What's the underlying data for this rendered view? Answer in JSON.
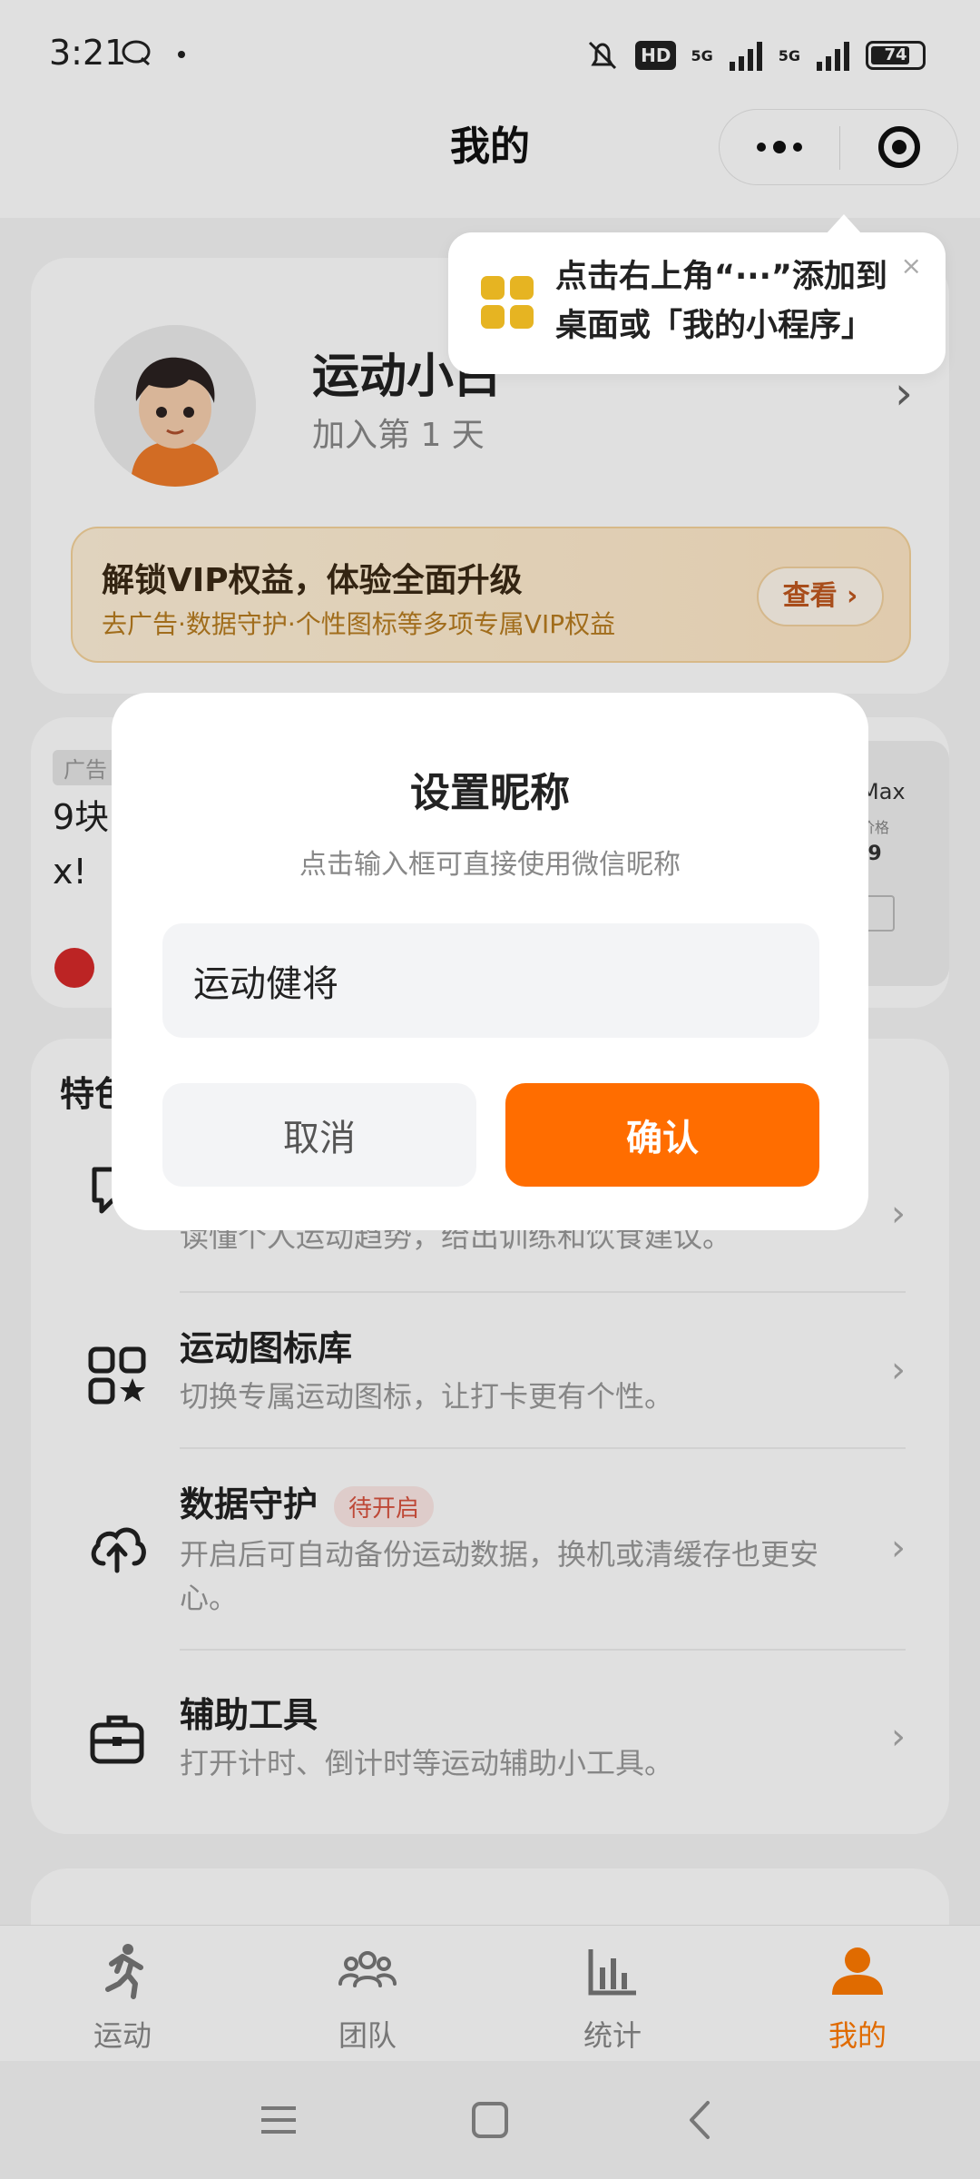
{
  "status_bar": {
    "time": "3:21",
    "hd_label": "HD",
    "network_1": "5G",
    "network_2": "5G",
    "battery": "74"
  },
  "nav": {
    "title": "我的"
  },
  "profile": {
    "nickname": "运动小白",
    "join_text": "加入第 1 天"
  },
  "vip": {
    "title": "解锁VIP权益，体验全面升级",
    "subtitle": "去广告·数据守护·个性图标等多项专属VIP权益",
    "button": "查看 ›"
  },
  "ad": {
    "tag": "广告",
    "text": "9块\nx!",
    "side_1": "Max",
    "side_2": "价格",
    "side_3": ".9"
  },
  "features": {
    "title": "特色",
    "items": [
      {
        "name": "",
        "desc": "读懂个人运动趋势，给出训练和饮食建议。",
        "icon": "ai-chat-icon"
      },
      {
        "name": "运动图标库",
        "desc": "切换专属运动图标，让打卡更有个性。",
        "icon": "icon-grid-icon"
      },
      {
        "name": "数据守护",
        "badge": "待开启",
        "desc": "开启后可自动备份运动数据，换机或清缓存也更安心。",
        "icon": "cloud-upload-icon"
      },
      {
        "name": "辅助工具",
        "desc": "打开计时、倒计时等运动辅助小工具。",
        "icon": "toolbox-icon"
      }
    ]
  },
  "tooltip": {
    "text": "点击右上角“···”添加到桌面或「我的小程序」",
    "close": "×"
  },
  "modal": {
    "title": "设置昵称",
    "subtitle": "点击输入框可直接使用微信昵称",
    "input_value": "运动健将",
    "cancel": "取消",
    "confirm": "确认"
  },
  "tabs": [
    {
      "label": "运动",
      "icon": "running-icon"
    },
    {
      "label": "团队",
      "icon": "team-icon"
    },
    {
      "label": "统计",
      "icon": "bar-chart-icon"
    },
    {
      "label": "我的",
      "icon": "person-icon",
      "active": true
    }
  ],
  "colors": {
    "accent": "#ff6d00",
    "tab_active": "#ff7a00",
    "vip_text": "#b87d20",
    "badge": "#d9533f"
  }
}
